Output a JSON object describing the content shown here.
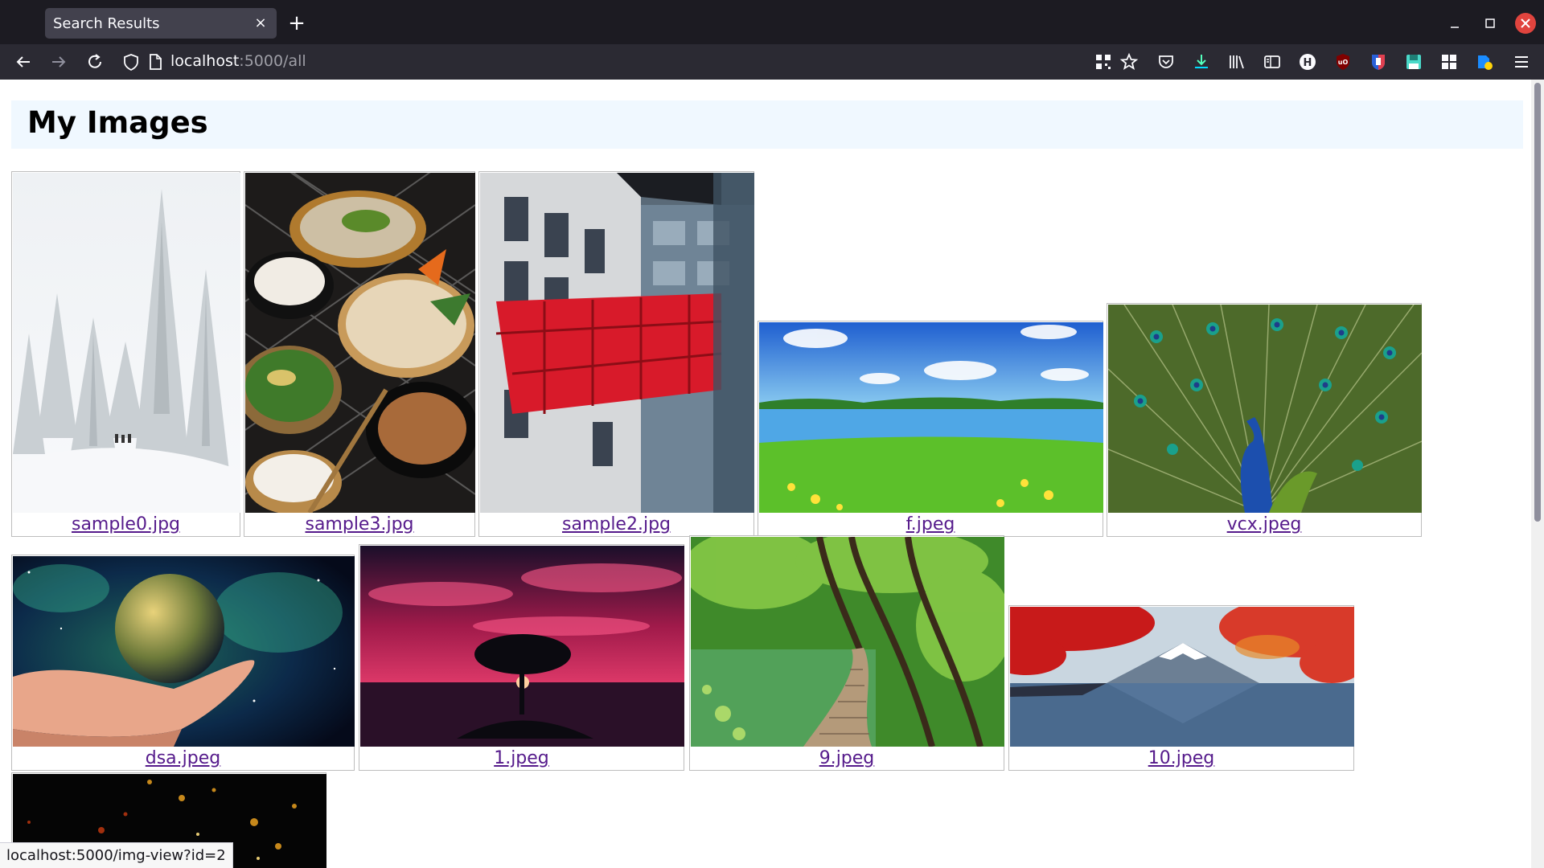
{
  "browser": {
    "tab_title": "Search Results",
    "tab_close": "×",
    "new_tab": "+",
    "url_host": "localhost",
    "url_rest": ":5000/all",
    "status_url": "localhost:5000/img-view?id=2",
    "icons": [
      "back-icon",
      "forward-icon",
      "reload-icon",
      "shield-icon",
      "page-icon",
      "qr-icon",
      "bookmark-star-icon",
      "pocket-icon",
      "download-icon",
      "library-icon",
      "sidebar-icon",
      "extension-h-icon",
      "ublock-icon",
      "shield-ext-icon",
      "save-ext-icon",
      "grid-ext-icon",
      "extension-badge-icon",
      "menu-icon"
    ]
  },
  "page": {
    "title": "My Images",
    "header_bg": "#f0f8ff"
  },
  "images": [
    {
      "name": "sample0.jpg",
      "subject": "snowy-forest"
    },
    {
      "name": "sample3.jpg",
      "subject": "food-bowls"
    },
    {
      "name": "sample2.jpg",
      "subject": "red-bridge-building"
    },
    {
      "name": "f.jpeg",
      "subject": "lake-meadow"
    },
    {
      "name": "vcx.jpeg",
      "subject": "peacock"
    },
    {
      "name": "dsa.jpeg",
      "subject": "earth-in-hand"
    },
    {
      "name": "1.jpeg",
      "subject": "tree-sunset"
    },
    {
      "name": "9.jpeg",
      "subject": "forest-boardwalk"
    },
    {
      "name": "10.jpeg",
      "subject": "mount-fuji-autumn"
    },
    {
      "name": "",
      "subject": "night-city-lights"
    }
  ]
}
